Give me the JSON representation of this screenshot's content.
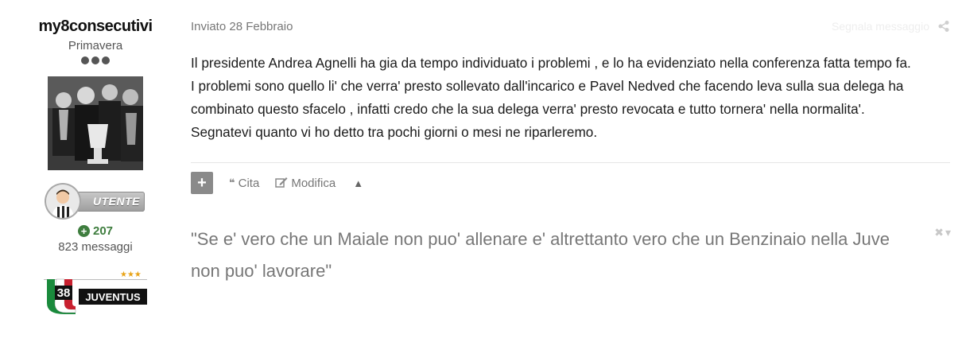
{
  "author": {
    "name": "my8consecutivi",
    "rank": "Primavera",
    "group_badge": "UTENTE",
    "reputation": "207",
    "post_count": "823 messaggi",
    "logo_text": "JUVENTUS",
    "logo_number": "38",
    "logo_stars": "★★★"
  },
  "post": {
    "date": "Inviato 28 Febbraio",
    "report_label": "Segnala messaggio",
    "content_lines": [
      "Il presidente Andrea Agnelli ha gia da tempo individuato i problemi , e lo ha evidenziato nella conferenza fatta tempo fa.",
      "I problemi sono quello li' che verra' presto sollevato dall'incarico e Pavel Nedved che facendo leva sulla sua delega ha",
      "combinato questo sfacelo , infatti credo che la sua delega verra' presto revocata e tutto tornera' nella normalita'.",
      "Segnatevi quanto vi ho detto tra pochi giorni o mesi ne riparleremo."
    ],
    "controls": {
      "multiquote": "+",
      "quote": "Cita",
      "edit": "Modifica",
      "up": "▲"
    }
  },
  "signature": {
    "lines": [
      "\"Se e' vero che un Maiale non puo' allenare e' altrettanto vero che un Benzinaio nella Juve",
      "non puo' lavorare\""
    ]
  }
}
